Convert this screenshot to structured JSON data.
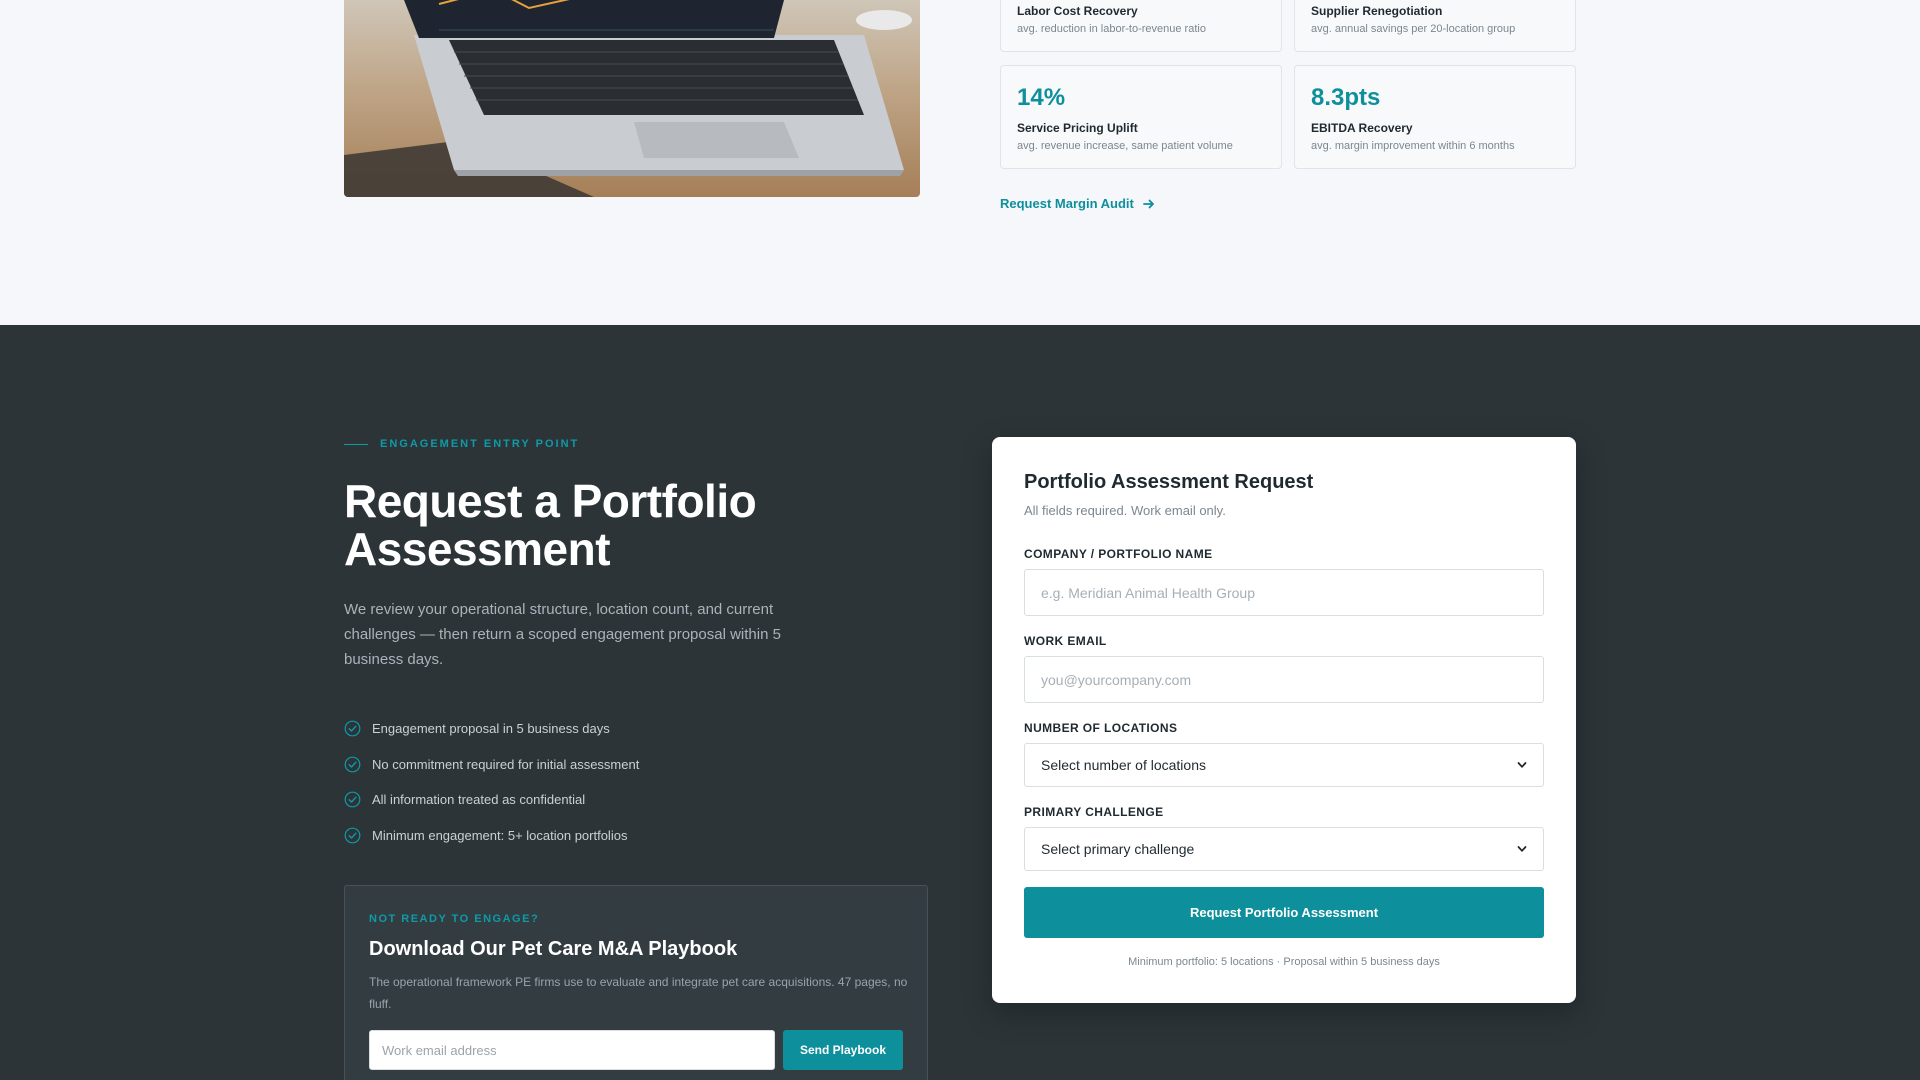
{
  "colors": {
    "accent": "#0e8f9c",
    "dark_bg": "#2c3438",
    "light_bg": "#f5f7fa"
  },
  "stats": [
    {
      "value": "",
      "name": "Labor Cost Recovery",
      "desc": "avg. reduction in labor-to-revenue ratio"
    },
    {
      "value": "",
      "name": "Supplier Renegotiation",
      "desc": "avg. annual savings per 20-location group"
    },
    {
      "value": "14%",
      "name": "Service Pricing Uplift",
      "desc": "avg. revenue increase, same patient volume"
    },
    {
      "value": "8.3pts",
      "name": "EBITDA Recovery",
      "desc": "avg. margin improvement within 6 months"
    }
  ],
  "audit_link": {
    "label": "Request Margin Audit",
    "icon": "arrow-right-icon"
  },
  "hero": {
    "eyebrow": "ENGAGEMENT ENTRY POINT",
    "title": "Request a Portfolio Assessment",
    "text": "We review your operational structure, location count, and current challenges — then return a scoped engagement proposal within 5 business days.",
    "checks": [
      "Engagement proposal in 5 business days",
      "No commitment required for initial assessment",
      "All information treated as confidential",
      "Minimum engagement: 5+ location portfolios"
    ]
  },
  "playbook": {
    "kicker": "NOT READY TO ENGAGE?",
    "title": "Download Our Pet Care M&A Playbook",
    "text": "The operational framework PE firms use to evaluate and integrate pet care acquisitions. 47 pages, no fluff.",
    "email_placeholder": "Work email address",
    "button": "Send Playbook"
  },
  "form": {
    "title": "Portfolio Assessment Request",
    "subtitle": "All fields required. Work email only.",
    "company_label": "COMPANY / PORTFOLIO NAME",
    "company_placeholder": "e.g. Meridian Animal Health Group",
    "email_label": "WORK EMAIL",
    "email_placeholder": "you@yourcompany.com",
    "locations_label": "NUMBER OF LOCATIONS",
    "locations_value": "Select number of locations",
    "challenge_label": "PRIMARY CHALLENGE",
    "challenge_value": "Select primary challenge",
    "submit": "Request Portfolio Assessment",
    "fineprint": "Minimum portfolio: 5 locations · Proposal within 5 business days"
  }
}
